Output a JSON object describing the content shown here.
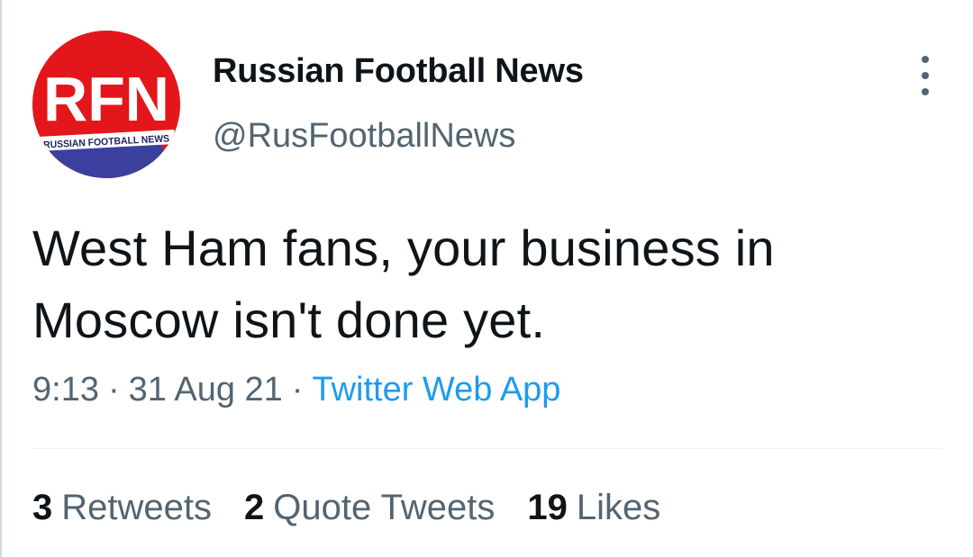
{
  "author": {
    "name": "Russian Football News",
    "handle": "@RusFootballNews",
    "avatar": {
      "initials": "RFN",
      "caption": "RUSSIAN FOOTBALL NEWS",
      "bg_color": "#e3171b",
      "accent_color": "#3b3f9e"
    }
  },
  "tweet": {
    "text_line_1": "West Ham fans, your business in",
    "text_line_2": "Moscow isn't done yet.",
    "time": "9:13",
    "date": "31 Aug 21",
    "source": "Twitter Web App",
    "separator": "·"
  },
  "stats": {
    "retweets_count": "3",
    "retweets_label": "Retweets",
    "quotes_count": "2",
    "quotes_label": "Quote Tweets",
    "likes_count": "19",
    "likes_label": "Likes"
  },
  "icons": {
    "more": "more-vertical-icon"
  },
  "colors": {
    "text_primary": "#0f1419",
    "text_secondary": "#536471",
    "link": "#1d9bf0",
    "divider": "#eff3f4"
  }
}
